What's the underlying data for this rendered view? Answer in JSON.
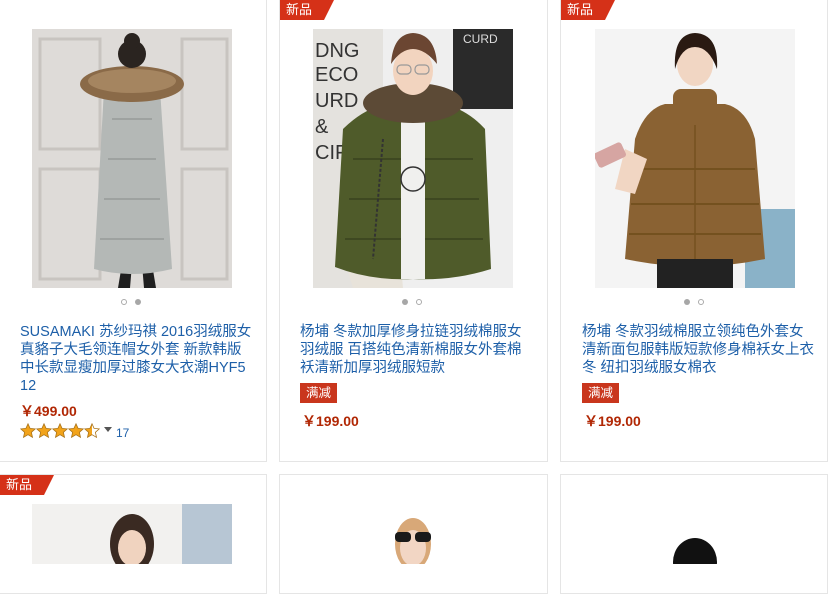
{
  "badge_label": "新品",
  "colors": {
    "link": "#1d5fa8",
    "price": "#b12704",
    "badge": "#d53118",
    "tag": "#c9361d"
  },
  "products": [
    {
      "title": "SUSAMAKI 苏纱玛祺 2016羽绒服女真貉子大毛领连帽女外套 新款韩版中长款显瘦加厚过膝女大衣潮HYF512",
      "price": "￥499.00",
      "rating": 4.5,
      "rating_count": "17",
      "image_dots": {
        "count": 2,
        "active": 2
      },
      "new": false
    },
    {
      "title": "杨埔 冬款加厚修身拉链羽绒棉服女羽绒服 百搭纯色清新棉服女外套棉袄清新加厚羽绒服短款",
      "tag": "满减",
      "price": "￥199.00",
      "image_dots": {
        "count": 2,
        "active": 1
      },
      "new": true
    },
    {
      "title": "杨埔 冬款羽绒棉服立领纯色外套女清新面包服韩版短款修身棉袄女上衣冬 纽扣羽绒服女棉衣",
      "tag": "满减",
      "price": "￥199.00",
      "image_dots": {
        "count": 2,
        "active": 1
      },
      "new": true
    },
    {
      "new": true
    },
    {
      "new": false
    },
    {
      "new": false
    }
  ]
}
